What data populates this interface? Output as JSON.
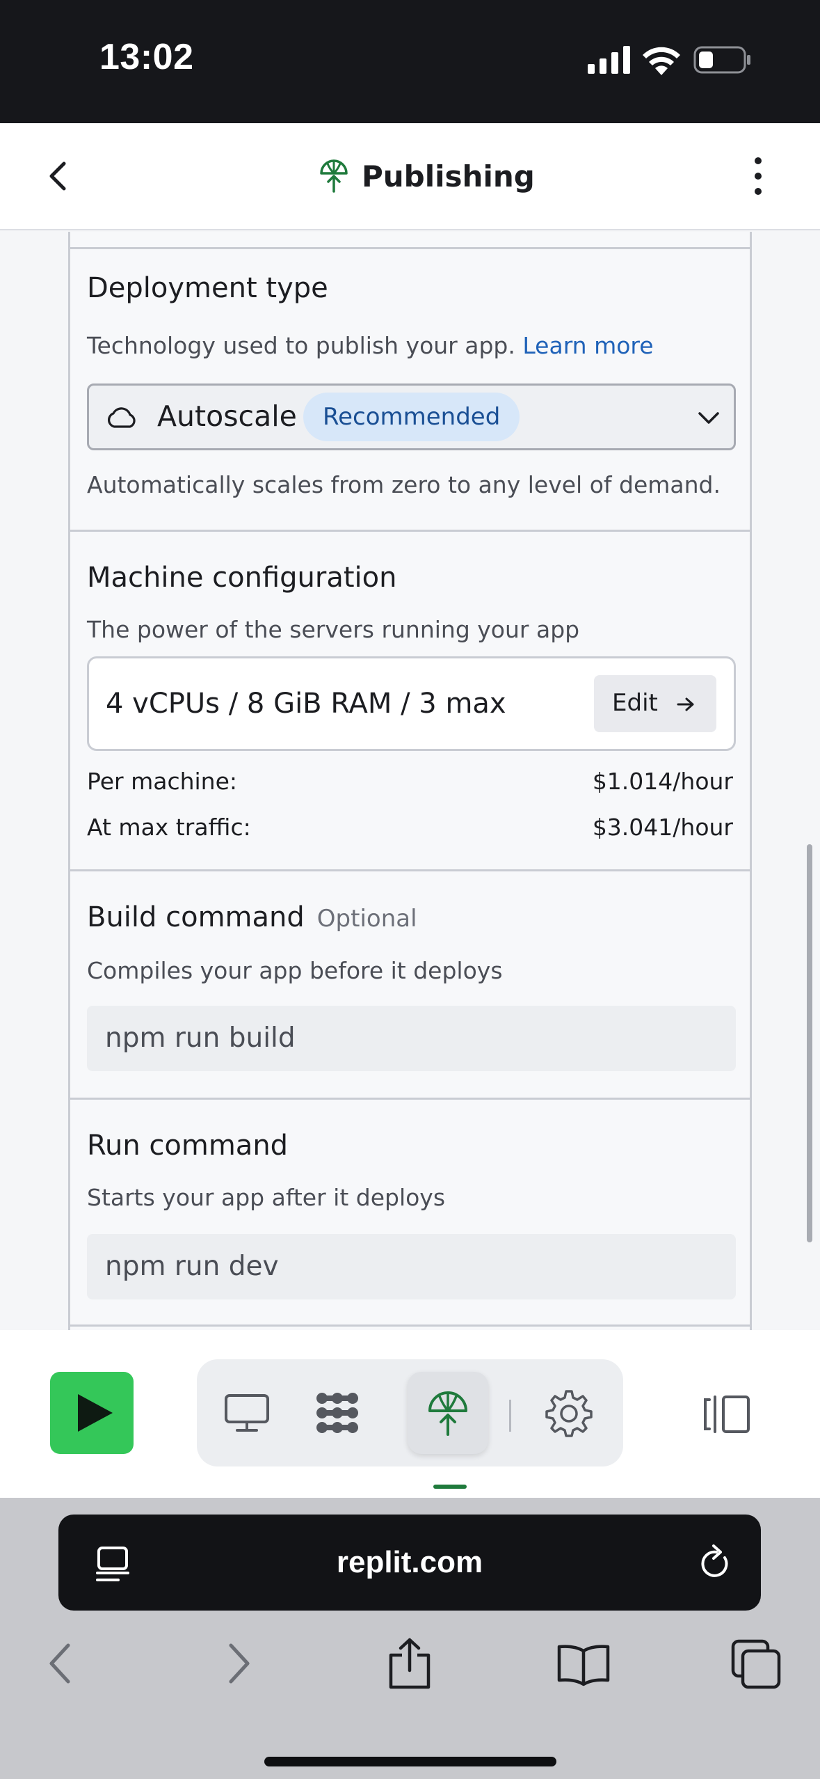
{
  "status_bar": {
    "time": "13:02"
  },
  "header": {
    "title": "Publishing"
  },
  "deployment_type": {
    "title": "Deployment type",
    "description": "Technology used to publish your app.",
    "learn_more": "Learn more",
    "selected": "Autoscale",
    "badge": "Recommended",
    "helper": "Automatically scales from zero to any level of demand."
  },
  "machine_config": {
    "title": "Machine configuration",
    "description": "The power of the servers running your app",
    "value": "4 vCPUs / 8 GiB RAM / 3 max",
    "edit_label": "Edit",
    "per_machine_label": "Per machine:",
    "per_machine_price": "$1.014/hour",
    "max_traffic_label": "At max traffic:",
    "max_traffic_price": "$3.041/hour"
  },
  "build_command": {
    "title": "Build command",
    "optional": "Optional",
    "description": "Compiles your app before it deploys",
    "value": "npm run build"
  },
  "run_command": {
    "title": "Run command",
    "description": "Starts your app after it deploys",
    "value": "npm run dev"
  },
  "toolbar": {
    "run_color": "#34c759",
    "tools": [
      "monitor-icon",
      "workflows-icon",
      "publishing-icon",
      "settings-icon"
    ],
    "active_tool": "publishing-icon"
  },
  "browser": {
    "url": "replit.com"
  },
  "colors": {
    "accent_green": "#1f7a3c",
    "link_blue": "#1f62b8",
    "badge_bg": "#d7e7f9"
  }
}
